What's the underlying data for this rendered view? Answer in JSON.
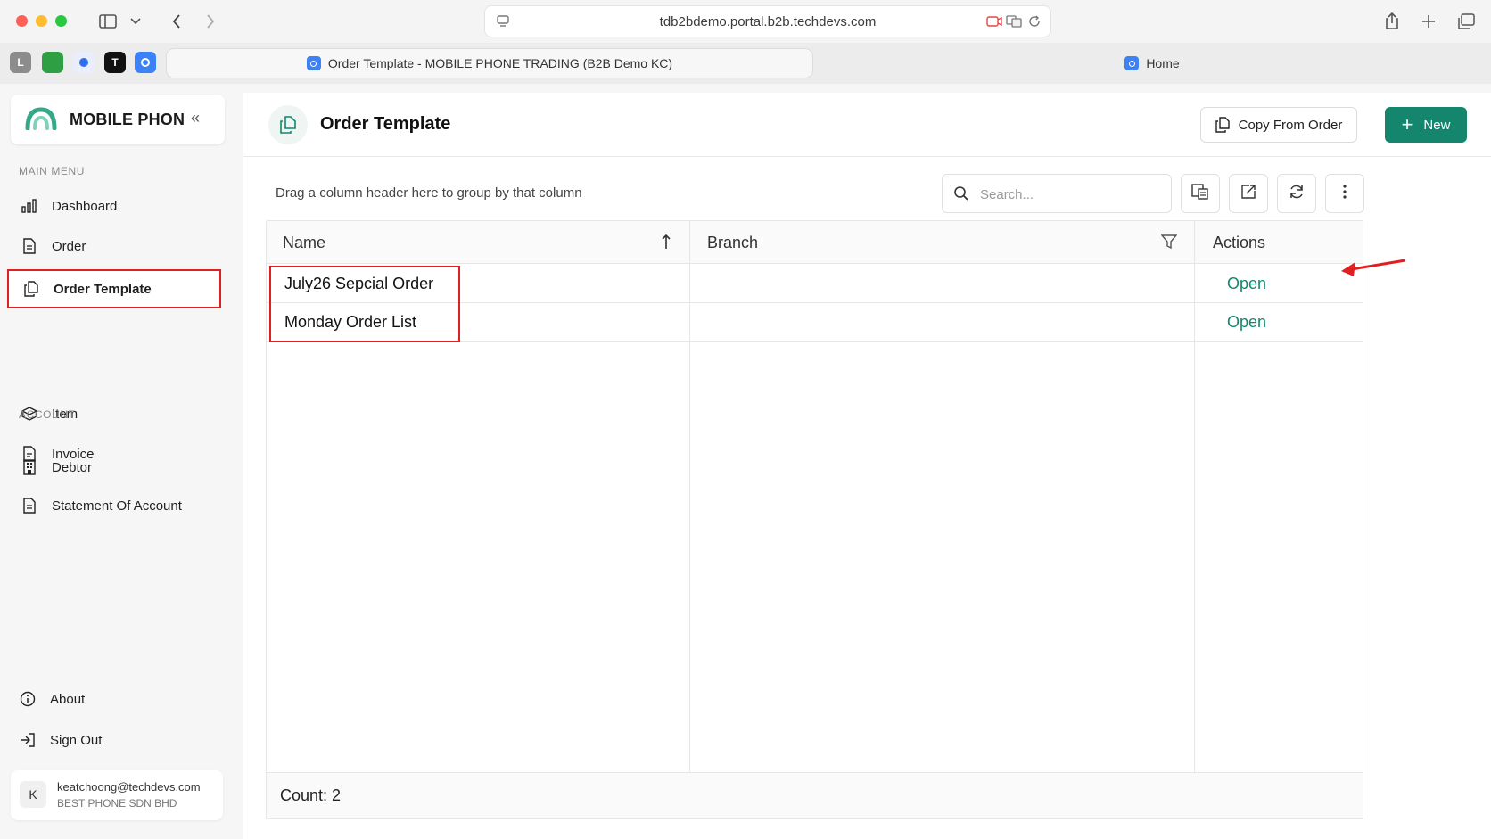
{
  "browser": {
    "url": "tdb2bdemo.portal.b2b.techdevs.com",
    "tabs": [
      {
        "label": "Order Template - MOBILE PHONE TRADING (B2B Demo KC)",
        "active": true
      },
      {
        "label": "Home",
        "active": false
      }
    ],
    "pinned_tabs": [
      "L",
      "",
      "",
      "T",
      ""
    ]
  },
  "sidebar": {
    "brand": "MOBILE PHON",
    "collapse_glyph": "«",
    "main_menu_label": "MAIN MENU",
    "account_label": "ACCOUNT",
    "main_items": [
      {
        "label": "Dashboard",
        "icon": "bar-chart-icon"
      },
      {
        "label": "Order",
        "icon": "document-icon"
      },
      {
        "label": "Order Template",
        "icon": "copy-document-icon",
        "active": true
      },
      {
        "label": "Item",
        "icon": "box-icon"
      },
      {
        "label": "Invoice",
        "icon": "invoice-icon"
      }
    ],
    "account_items": [
      {
        "label": "Debtor",
        "icon": "building-icon"
      },
      {
        "label": "Statement Of Account",
        "icon": "statement-icon"
      }
    ],
    "bottom_items": [
      {
        "label": "About",
        "icon": "info-icon"
      },
      {
        "label": "Sign Out",
        "icon": "sign-out-icon"
      }
    ],
    "user": {
      "initial": "K",
      "email": "keatchoong@techdevs.com",
      "company": "BEST PHONE SDN BHD"
    }
  },
  "main": {
    "title": "Order Template",
    "copy_button": "Copy From Order",
    "new_button": "New",
    "group_hint": "Drag a column header here to group by that column",
    "search_placeholder": "Search...",
    "columns": [
      "Name",
      "Branch",
      "Actions"
    ],
    "rows": [
      {
        "name": "July26 Sepcial Order",
        "branch": "",
        "action": "Open"
      },
      {
        "name": "Monday Order List",
        "branch": "",
        "action": "Open"
      }
    ],
    "count_text": "Count: 2"
  },
  "colors": {
    "accent": "#14866d",
    "highlight": "#e02020"
  }
}
